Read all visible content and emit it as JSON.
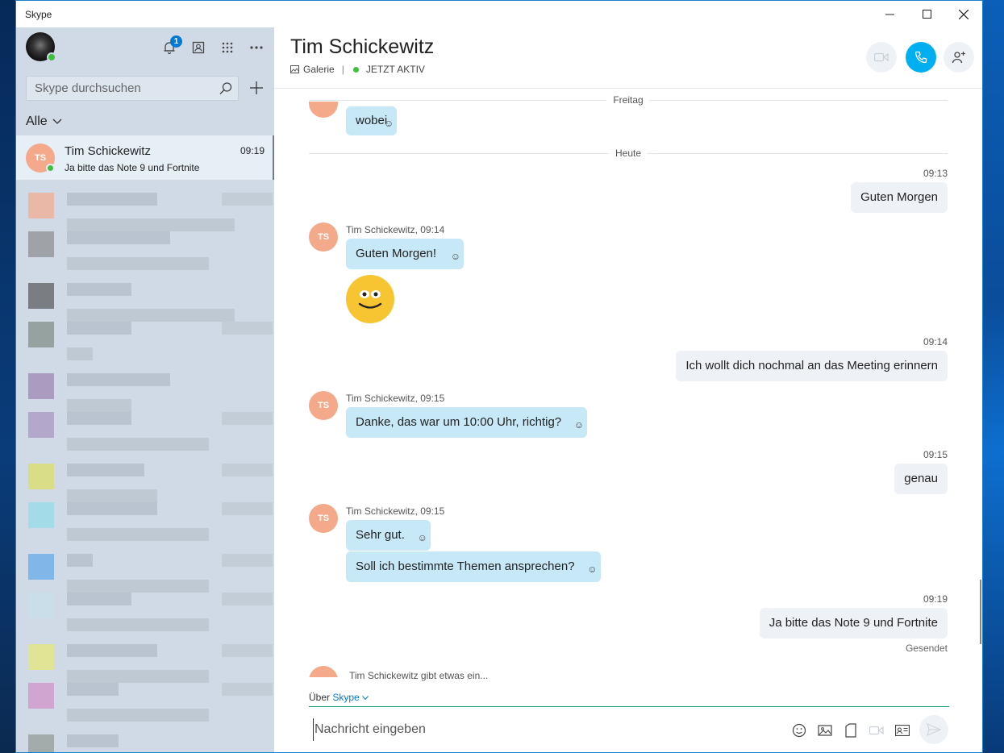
{
  "window": {
    "title": "Skype"
  },
  "sidebar": {
    "notification_count": "1",
    "search_placeholder": "Skype durchsuchen",
    "filter_label": "Alle",
    "active_chat": {
      "initials": "TS",
      "name": "Tim Schickewitz",
      "time": "09:19",
      "preview": "Ja bitte das Note 9 und Fortnite"
    }
  },
  "header": {
    "contact_name": "Tim Schickewitz",
    "gallery_label": "Galerie",
    "status": "JETZT AKTIV"
  },
  "conversation": {
    "separators": [
      "Freitag",
      "Heute"
    ],
    "earlier_message": "wobei",
    "messages": [
      {
        "dir": "out",
        "time": "09:13",
        "text": "Guten Morgen"
      },
      {
        "dir": "in",
        "meta": "Tim Schickewitz, 09:14",
        "text": "Guten Morgen!"
      },
      {
        "dir": "out",
        "time": "09:14",
        "text": "Ich wollt dich nochmal an das Meeting erinnern"
      },
      {
        "dir": "in",
        "meta": "Tim Schickewitz, 09:15",
        "text": "Danke, das war um 10:00 Uhr, richtig?"
      },
      {
        "dir": "out",
        "time": "09:15",
        "text": "genau"
      },
      {
        "dir": "in",
        "meta": "Tim Schickewitz, 09:15",
        "text": "Sehr gut."
      },
      {
        "dir": "in",
        "text": "Soll ich bestimmte Themen ansprechen?"
      },
      {
        "dir": "out",
        "time": "09:19",
        "text": "Ja bitte das Note 9 und Fortnite",
        "status": "Gesendet"
      }
    ],
    "typing_indicator": "Tim Schickewitz gibt etwas ein..."
  },
  "composer": {
    "via_prefix": "Über",
    "via_service": "Skype",
    "placeholder": "Nachricht eingeben"
  },
  "colors": {
    "sidebar_bg": "#cfdae6",
    "incoming_bubble": "#c7e8f7",
    "outgoing_bubble": "#eef1f5",
    "accent": "#00aff0",
    "avatar": "#f3a98a",
    "online": "#3fbf3f"
  }
}
